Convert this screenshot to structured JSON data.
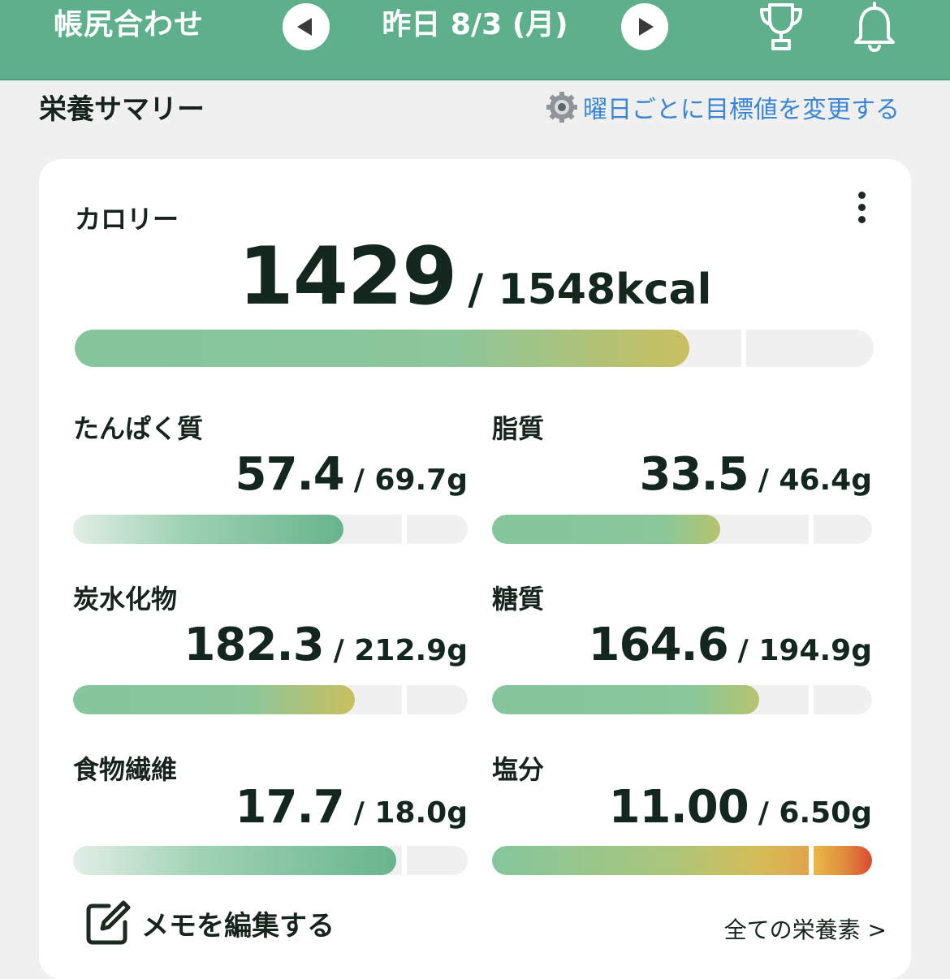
{
  "header": {
    "app_title": "帳尻合わせ",
    "date_label": "昨日 8/3 (月)",
    "prev_icon": "chevron-left-icon",
    "next_icon": "chevron-right-icon",
    "trophy_icon": "trophy-icon",
    "bell_icon": "bell-icon",
    "brand_color": "#5db08b"
  },
  "section": {
    "title": "栄養サマリー",
    "goal_link": "曜日ごとに目標値を変更する",
    "goal_icon": "gear-icon",
    "link_color": "#3a86d6"
  },
  "calorie": {
    "label": "カロリー",
    "value": "1429",
    "target": "/ 1548kcal",
    "progress": 0.923
  },
  "nutrients": [
    {
      "label": "たんぱく質",
      "value": "57.4",
      "target": "/ 69.7g",
      "progress": 0.82
    },
    {
      "label": "脂質",
      "value": "33.5",
      "target": "/ 46.4g",
      "progress": 0.72
    },
    {
      "label": "炭水化物",
      "value": "182.3",
      "target": "/ 212.9g",
      "progress": 0.86
    },
    {
      "label": "糖質",
      "value": "164.6",
      "target": "/ 194.9g",
      "progress": 0.84
    },
    {
      "label": "食物繊維",
      "value": "17.7",
      "target": "/ 18.0g",
      "progress": 0.98
    },
    {
      "label": "塩分",
      "value": "11.00",
      "target": "/ 6.50g",
      "progress": 1.69
    }
  ],
  "footer": {
    "memo_label": "メモを編集する",
    "memo_icon": "edit-icon",
    "all_nutrients": "全ての栄養素 >"
  }
}
